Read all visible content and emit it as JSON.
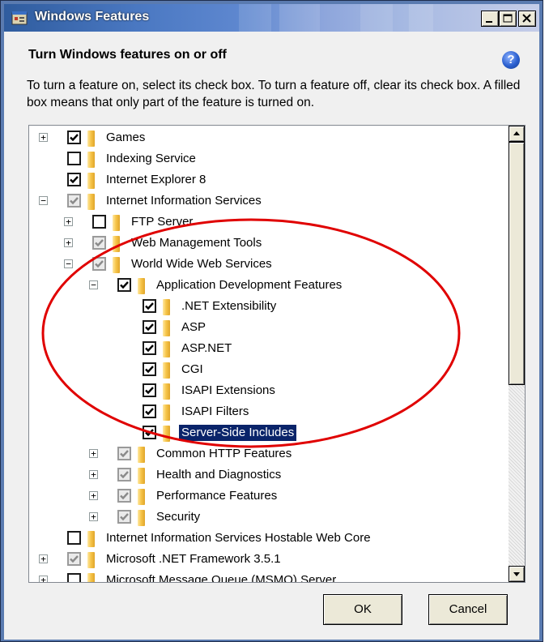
{
  "window": {
    "title": "Windows Features",
    "app_icon": "windows-features-icon",
    "controls": {
      "minimize": "minimize-icon",
      "maximize": "maximize-icon",
      "close": "close-icon"
    }
  },
  "dialog": {
    "heading": "Turn Windows features on or off",
    "help_icon": "help-icon",
    "help_glyph": "?",
    "description": "To turn a feature on, select its check box. To turn a feature off, clear its check box. A filled box means that only part of the feature is turned on."
  },
  "tree": {
    "items": [
      {
        "label": "Games",
        "level": 0,
        "expander": "+",
        "state": "checked"
      },
      {
        "label": "Indexing Service",
        "level": 0,
        "expander": "",
        "state": "unchecked"
      },
      {
        "label": "Internet Explorer 8",
        "level": 0,
        "expander": "",
        "state": "checked"
      },
      {
        "label": "Internet Information Services",
        "level": 0,
        "expander": "−",
        "state": "partial"
      },
      {
        "label": "FTP Server",
        "level": 1,
        "expander": "+",
        "state": "unchecked"
      },
      {
        "label": "Web Management Tools",
        "level": 1,
        "expander": "+",
        "state": "partial"
      },
      {
        "label": "World Wide Web Services",
        "level": 1,
        "expander": "−",
        "state": "partial"
      },
      {
        "label": "Application Development Features",
        "level": 2,
        "expander": "−",
        "state": "checked"
      },
      {
        "label": ".NET Extensibility",
        "level": 3,
        "expander": "",
        "state": "checked"
      },
      {
        "label": "ASP",
        "level": 3,
        "expander": "",
        "state": "checked"
      },
      {
        "label": "ASP.NET",
        "level": 3,
        "expander": "",
        "state": "checked"
      },
      {
        "label": "CGI",
        "level": 3,
        "expander": "",
        "state": "checked"
      },
      {
        "label": "ISAPI Extensions",
        "level": 3,
        "expander": "",
        "state": "checked"
      },
      {
        "label": "ISAPI Filters",
        "level": 3,
        "expander": "",
        "state": "checked"
      },
      {
        "label": "Server-Side Includes",
        "level": 3,
        "expander": "",
        "state": "checked",
        "selected": true
      },
      {
        "label": "Common HTTP Features",
        "level": 2,
        "expander": "+",
        "state": "partial"
      },
      {
        "label": "Health and Diagnostics",
        "level": 2,
        "expander": "+",
        "state": "partial"
      },
      {
        "label": "Performance Features",
        "level": 2,
        "expander": "+",
        "state": "partial"
      },
      {
        "label": "Security",
        "level": 2,
        "expander": "+",
        "state": "partial"
      },
      {
        "label": "Internet Information Services Hostable Web Core",
        "level": 0,
        "expander": "",
        "state": "unchecked"
      },
      {
        "label": "Microsoft .NET Framework 3.5.1",
        "level": 0,
        "expander": "+",
        "state": "partial"
      },
      {
        "label": "Microsoft Message Queue (MSMQ) Server",
        "level": 0,
        "expander": "+",
        "state": "unchecked"
      }
    ]
  },
  "scrollbar": {
    "up_icon": "scroll-up-arrow-icon",
    "down_icon": "scroll-down-arrow-icon"
  },
  "buttons": {
    "ok": "OK",
    "cancel": "Cancel"
  },
  "colors": {
    "annotation": "#e00000",
    "selection": "#0a246a",
    "titlebar": "#2f5c9e"
  },
  "annotation": {
    "shape": "ellipse",
    "color_name": "red"
  }
}
